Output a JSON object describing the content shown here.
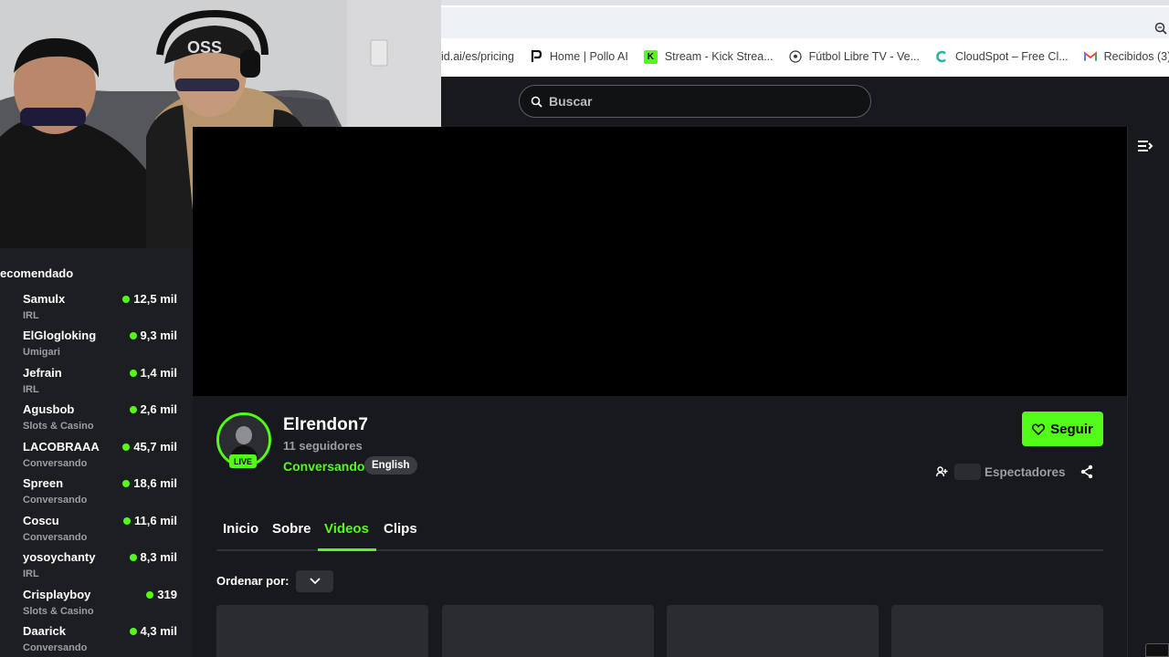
{
  "browser": {
    "bookmarks": [
      {
        "label": "id.ai/es/pricing",
        "icon": "pricing-page-icon",
        "color": "#888888"
      },
      {
        "label": "Home | Pollo AI",
        "icon": "pollo-ai-icon",
        "color": "#111111"
      },
      {
        "label": "Stream - Kick Strea...",
        "icon": "kick-icon",
        "color": "#53fc18"
      },
      {
        "label": "Fútbol Libre TV - Ve...",
        "icon": "soccer-ball-icon",
        "color": "#333333"
      },
      {
        "label": "CloudSpot – Free Cl...",
        "icon": "cloudspot-icon",
        "color": "#2bb3a3"
      },
      {
        "label": "Recibidos (3) -",
        "icon": "gmail-icon",
        "color": "#ea4335"
      }
    ]
  },
  "header": {
    "search_placeholder": "Buscar"
  },
  "sidebar": {
    "title": "ecomendado",
    "channels": [
      {
        "name": "Samulx",
        "category": "IRL",
        "viewers": "12,5 mil"
      },
      {
        "name": "ElGlogloking",
        "category": "Umigari",
        "viewers": "9,3 mil"
      },
      {
        "name": "Jefrain",
        "category": "IRL",
        "viewers": "1,4 mil"
      },
      {
        "name": "Agusbob",
        "category": "Slots & Casino",
        "viewers": "2,6 mil"
      },
      {
        "name": "LACOBRAAA",
        "category": "Conversando",
        "viewers": "45,7 mil"
      },
      {
        "name": "Spreen",
        "category": "Conversando",
        "viewers": "18,6 mil"
      },
      {
        "name": "Coscu",
        "category": "Conversando",
        "viewers": "11,6 mil"
      },
      {
        "name": "yosoychanty",
        "category": "IRL",
        "viewers": "8,3 mil"
      },
      {
        "name": "Crisplayboy",
        "category": "Slots & Casino",
        "viewers": "319"
      },
      {
        "name": "Daarick",
        "category": "Conversando",
        "viewers": "4,3 mil"
      }
    ]
  },
  "channel": {
    "name": "Elrendon7",
    "followers": "11 seguidores",
    "category": "Conversando",
    "language": "English",
    "live_badge": "LIVE",
    "follow_label": "Seguir",
    "viewers_label": "Espectadores"
  },
  "tabs": [
    {
      "label": "Inicio",
      "active": false
    },
    {
      "label": "Sobre",
      "active": false
    },
    {
      "label": "Videos",
      "active": true
    },
    {
      "label": "Clips",
      "active": false
    }
  ],
  "sort": {
    "label": "Ordenar por:"
  },
  "colors": {
    "accent": "#53fc18",
    "background": "#18191c",
    "sidebar": "#1d1e21"
  }
}
